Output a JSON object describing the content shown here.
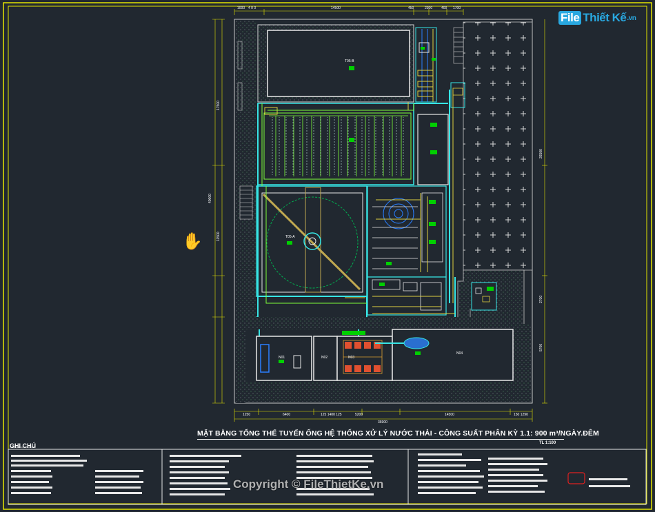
{
  "logo": {
    "file": "File",
    "name": "Thiết Kế",
    "domain": ".vn"
  },
  "drawing": {
    "title": "MẶT BẰNG TỔNG THỂ TUYẾN ỐNG HỆ THỐNG XỬ LÝ NƯỚC THẢI - CÔNG SUẤT PHÂN KỲ 1.1: 900 m³/NGÀY.ĐÊM",
    "scale": "TL 1:100"
  },
  "rooms": {
    "t05b": "T05-B",
    "t05a": "T05-A",
    "n01": "N01",
    "n02": "N02",
    "n03": "N03",
    "n04": "N04"
  },
  "notes": {
    "label": "GHI CHÚ"
  },
  "watermark": "Copyright © FileThietKe.vn",
  "colors": {
    "background": "#212830",
    "border": "#e4e400",
    "wall": "#c8c8c8",
    "pipe_cyan": "#37e6e6",
    "pipe_blue": "#2a7fff",
    "pipe_green": "#7fff3a",
    "pipe_yellow": "#e0d040",
    "tag_green": "#00d000"
  }
}
